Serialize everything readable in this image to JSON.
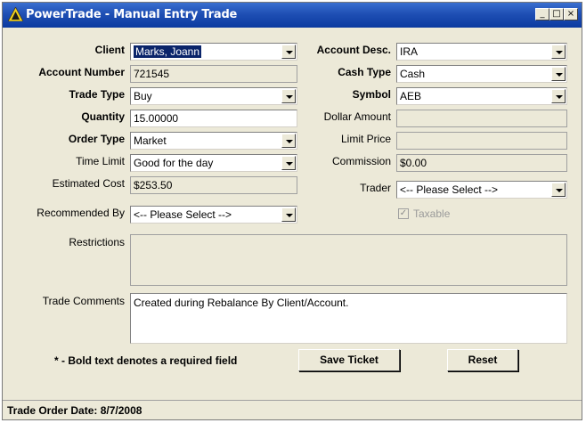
{
  "window": {
    "title": "PowerTrade - Manual Entry Trade",
    "controls": {
      "minimize": "_",
      "maximize": "□",
      "close": "×"
    }
  },
  "form": {
    "client": {
      "label": "Client",
      "value": "Marks, Joann"
    },
    "account_number": {
      "label": "Account Number",
      "value": "721545"
    },
    "trade_type": {
      "label": "Trade Type",
      "value": "Buy"
    },
    "quantity": {
      "label": "Quantity",
      "value": "15.00000"
    },
    "order_type": {
      "label": "Order Type",
      "value": "Market"
    },
    "time_limit": {
      "label": "Time Limit",
      "value": "Good for the day"
    },
    "estimated_cost": {
      "label": "Estimated Cost",
      "value": "$253.50"
    },
    "recommended_by": {
      "label": "Recommended By",
      "value": "<-- Please Select -->"
    },
    "account_desc": {
      "label": "Account Desc.",
      "value": "IRA"
    },
    "cash_type": {
      "label": "Cash Type",
      "value": "Cash"
    },
    "symbol": {
      "label": "Symbol",
      "value": "AEB"
    },
    "dollar_amount": {
      "label": "Dollar Amount",
      "value": ""
    },
    "limit_price": {
      "label": "Limit Price",
      "value": ""
    },
    "commission": {
      "label": "Commission",
      "value": "$0.00"
    },
    "trader": {
      "label": "Trader",
      "value": "<-- Please Select -->"
    },
    "taxable": {
      "label": "Taxable",
      "checked": true
    },
    "restrictions": {
      "label": "Restrictions",
      "value": ""
    },
    "trade_comments": {
      "label": "Trade Comments",
      "value": "Created during Rebalance By Client/Account."
    }
  },
  "footer": {
    "required_note": "* - Bold text denotes a required field",
    "save_button": "Save Ticket",
    "reset_button": "Reset"
  },
  "status": {
    "text": "Trade Order Date: 8/7/2008"
  },
  "colors": {
    "titlebar": "#0b3aa0",
    "window_bg": "#ece9d8",
    "selection": "#0a246a"
  }
}
